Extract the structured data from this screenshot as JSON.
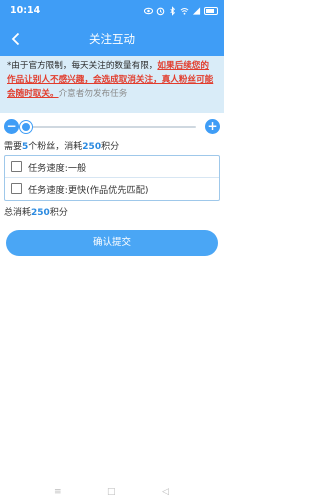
{
  "status_bar": {
    "time": "10:14",
    "icons": [
      "eye-icon",
      "alarm-icon",
      "bluetooth-icon",
      "wifi-icon",
      "signal-icon",
      "battery-icon"
    ]
  },
  "header": {
    "title": "关注互动",
    "back_icon": "chevron-left-icon"
  },
  "notice": {
    "normal": "*由于官方限制，每天关注的数量有限，",
    "warning": "如果后续您的作品让别人不感兴趣，会选成取消关注，真人粉丝可能会随时取关。",
    "footer": "介意者勿发布任务"
  },
  "slider": {
    "minus_label": "−",
    "plus_label": "+",
    "value": 5,
    "min": 5,
    "max": 500
  },
  "requirement": {
    "prefix": "需要",
    "count": "5",
    "mid": "个粉丝，消耗",
    "points": "250",
    "suffix": "积分"
  },
  "options": [
    {
      "label": "任务速度:一般",
      "checked": false
    },
    {
      "label": "任务速度:更快(作品优先匹配)",
      "checked": false
    }
  ],
  "total": {
    "prefix": "总消耗",
    "points": "250",
    "suffix": "积分"
  },
  "submit_label": "确认提交",
  "nav": {
    "menu_label": "≡",
    "home_label": "□",
    "back_label": "◁"
  },
  "colors": {
    "primary": "#3f9df6",
    "warning": "#e23c2c",
    "accent_text": "#2b8ae0"
  }
}
